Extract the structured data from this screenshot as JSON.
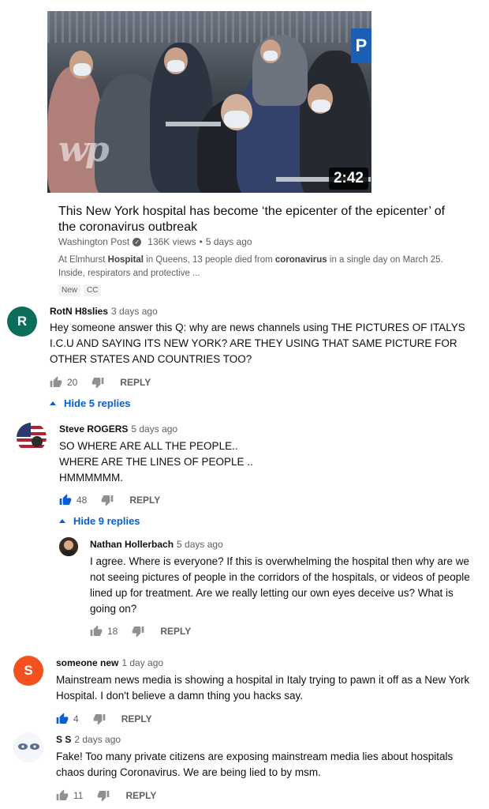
{
  "video": {
    "duration": "2:42",
    "watermark": "wp",
    "title": "This New York hospital has become ‘the epicenter of the epicenter’ of the coronavirus outbreak",
    "channel": "Washington Post",
    "views": "136K views",
    "dot": "•",
    "age": "5 days ago",
    "desc_part1": "At Elmhurst ",
    "desc_bold1": "Hospital",
    "desc_part2": " in Queens, 13 people died from ",
    "desc_bold2": "coronavirus",
    "desc_part3": " in a single day on March 25. Inside, respirators and protective ...",
    "badges": [
      "New",
      "CC"
    ]
  },
  "comments": [
    {
      "avatar_letter": "R",
      "avatar_color": "#0b6d5a",
      "author": "RotN H8slies",
      "time": "3 days ago",
      "text": "Hey someone answer this Q: why are news channels using THE PICTURES OF ITALYS I.C.U AND SAYING ITS NEW YORK? ARE THEY USING THAT SAME PICTURE FOR OTHER STATES AND COUNTRIES TOO?",
      "likes": "20",
      "reply": "REPLY",
      "toggle": "Hide 5 replies"
    },
    {
      "author": "Steve ROGERS",
      "time": "5 days ago",
      "lines": [
        "SO WHERE ARE ALL THE PEOPLE..",
        "WHERE ARE THE LINES OF PEOPLE ..",
        "HMMMMMM."
      ],
      "likes": "48",
      "reply": "REPLY",
      "toggle": "Hide 9 replies"
    },
    {
      "author": "Nathan Hollerbach",
      "time": "5 days ago",
      "text": "I agree.  Where is everyone?  If this is overwhelming the hospital then why are we not seeing pictures of people in the corridors of the hospitals, or videos of people lined up for treatment.  Are we really letting our own eyes deceive us?  What is going on?",
      "likes": "18",
      "reply": "REPLY"
    },
    {
      "avatar_letter": "S",
      "avatar_color": "#f4511e",
      "author": "someone new",
      "time": "1 day ago",
      "text": "Mainstream news media is showing a hospital in Italy trying to pawn it off as a New York Hospital. I don't believe a damn thing you hacks say.",
      "likes": "4",
      "reply": "REPLY"
    },
    {
      "author": "S S",
      "time": "2 days ago",
      "text": "Fake!  Too many private citizens are exposing mainstream media lies about hospitals chaos during Coronavirus.  We are being lied to by msm.",
      "likes": "11",
      "reply": "REPLY"
    }
  ],
  "colors": {
    "link_blue": "#065fd4",
    "secondary_text": "#606060"
  },
  "icons": [
    "thumbs-up-icon",
    "thumbs-down-icon",
    "verified-check-icon",
    "chevron-up-icon"
  ]
}
